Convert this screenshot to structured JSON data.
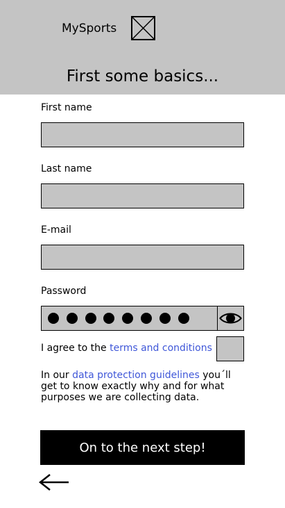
{
  "header": {
    "app_name": "MySports",
    "logo_icon": "image-placeholder-icon",
    "title": "First some basics..."
  },
  "form": {
    "first_name": {
      "label": "First name",
      "value": ""
    },
    "last_name": {
      "label": "Last name",
      "value": ""
    },
    "email": {
      "label": "E-mail",
      "value": ""
    },
    "password": {
      "label": "Password",
      "masked_length": 8,
      "toggle_icon": "eye-icon"
    }
  },
  "consent": {
    "prefix": "I agree to the ",
    "terms_link": "terms and conditions",
    "checked": false
  },
  "privacy": {
    "prefix": "In our ",
    "link": "data protection guidelines",
    "suffix": " you´ll get to know exactly why and for what purposes we are collecting data."
  },
  "actions": {
    "next_label": "On to the next step!",
    "back_icon": "arrow-left-icon"
  },
  "colors": {
    "panel_gray": "#c4c4c4",
    "link_blue": "#3f57d8",
    "button_black": "#000000"
  }
}
